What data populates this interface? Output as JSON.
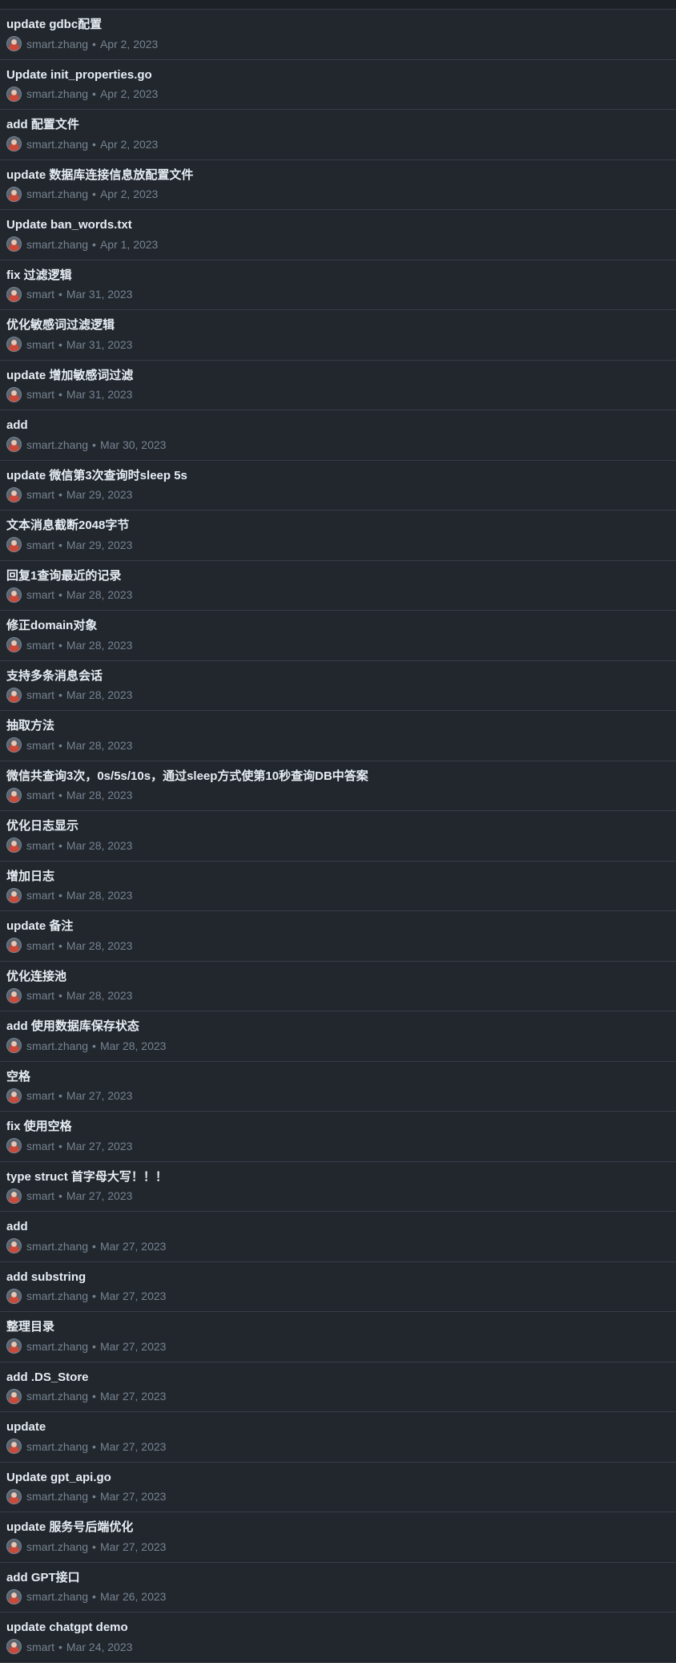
{
  "separator": "•",
  "commits": [
    {
      "title": "update gdbc配置",
      "author": "smart.zhang",
      "date": "Apr 2, 2023"
    },
    {
      "title": "Update init_properties.go",
      "author": "smart.zhang",
      "date": "Apr 2, 2023"
    },
    {
      "title": "add 配置文件",
      "author": "smart.zhang",
      "date": "Apr 2, 2023"
    },
    {
      "title": "update 数据库连接信息放配置文件",
      "author": "smart.zhang",
      "date": "Apr 2, 2023"
    },
    {
      "title": "Update ban_words.txt",
      "author": "smart.zhang",
      "date": "Apr 1, 2023"
    },
    {
      "title": "fix 过滤逻辑",
      "author": "smart",
      "date": "Mar 31, 2023"
    },
    {
      "title": "优化敏感词过滤逻辑",
      "author": "smart",
      "date": "Mar 31, 2023"
    },
    {
      "title": "update 增加敏感词过滤",
      "author": "smart",
      "date": "Mar 31, 2023"
    },
    {
      "title": "add",
      "author": "smart.zhang",
      "date": "Mar 30, 2023"
    },
    {
      "title": "update 微信第3次查询时sleep 5s",
      "author": "smart",
      "date": "Mar 29, 2023"
    },
    {
      "title": "文本消息截断2048字节",
      "author": "smart",
      "date": "Mar 29, 2023"
    },
    {
      "title": "回复1查询最近的记录",
      "author": "smart",
      "date": "Mar 28, 2023"
    },
    {
      "title": "修正domain对象",
      "author": "smart",
      "date": "Mar 28, 2023"
    },
    {
      "title": "支持多条消息会话",
      "author": "smart",
      "date": "Mar 28, 2023"
    },
    {
      "title": "抽取方法",
      "author": "smart",
      "date": "Mar 28, 2023"
    },
    {
      "title": "微信共查询3次，0s/5s/10s，通过sleep方式使第10秒查询DB中答案",
      "author": "smart",
      "date": "Mar 28, 2023"
    },
    {
      "title": "优化日志显示",
      "author": "smart",
      "date": "Mar 28, 2023"
    },
    {
      "title": "增加日志",
      "author": "smart",
      "date": "Mar 28, 2023"
    },
    {
      "title": "update 备注",
      "author": "smart",
      "date": "Mar 28, 2023"
    },
    {
      "title": "优化连接池",
      "author": "smart",
      "date": "Mar 28, 2023"
    },
    {
      "title": "add 使用数据库保存状态",
      "author": "smart.zhang",
      "date": "Mar 28, 2023"
    },
    {
      "title": "空格",
      "author": "smart",
      "date": "Mar 27, 2023"
    },
    {
      "title": "fix 使用空格",
      "author": "smart",
      "date": "Mar 27, 2023"
    },
    {
      "title": "type struct 首字母大写！！！",
      "author": "smart",
      "date": "Mar 27, 2023"
    },
    {
      "title": "add",
      "author": "smart.zhang",
      "date": "Mar 27, 2023"
    },
    {
      "title": "add substring",
      "author": "smart.zhang",
      "date": "Mar 27, 2023"
    },
    {
      "title": "整理目录",
      "author": "smart.zhang",
      "date": "Mar 27, 2023"
    },
    {
      "title": "add .DS_Store",
      "author": "smart.zhang",
      "date": "Mar 27, 2023"
    },
    {
      "title": "update",
      "author": "smart.zhang",
      "date": "Mar 27, 2023"
    },
    {
      "title": "Update gpt_api.go",
      "author": "smart.zhang",
      "date": "Mar 27, 2023"
    },
    {
      "title": "update 服务号后端优化",
      "author": "smart.zhang",
      "date": "Mar 27, 2023"
    },
    {
      "title": "add GPT接口",
      "author": "smart.zhang",
      "date": "Mar 26, 2023"
    },
    {
      "title": "update chatgpt demo",
      "author": "smart",
      "date": "Mar 24, 2023"
    }
  ]
}
